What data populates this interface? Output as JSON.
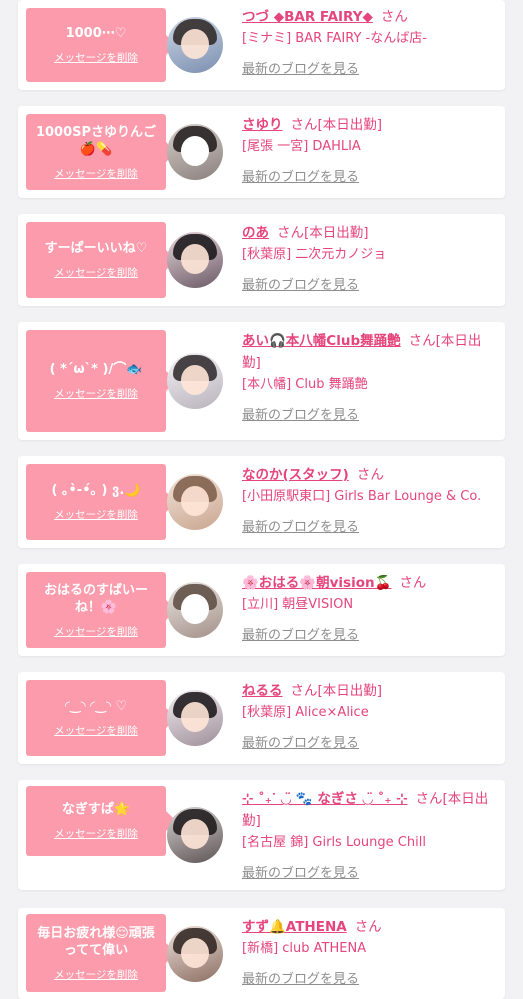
{
  "delete_label": "メッセージを削除",
  "blog_label": "最新のブログを見る",
  "honorific": "さん",
  "colors": {
    "bubble": "#fb9bab",
    "accent": "#e5457b",
    "link_gray": "#8e8e8e",
    "background": "#f2f1f3"
  },
  "items": [
    {
      "message": "1000⋯♡",
      "name": "つづ ◆BAR FAIRY◆",
      "status": "",
      "shop": "[ミナミ] BAR FAIRY -なんば店-"
    },
    {
      "message": "1000SPさゆりんご🍎💊",
      "name": "さゆり",
      "status": "[本日出勤]",
      "shop": "[尾張 一宮] DAHLIA"
    },
    {
      "message": "すーぱーいいね♡",
      "name": "のあ",
      "status": "[本日出勤]",
      "shop": "[秋葉原] 二次元カノジョ"
    },
    {
      "message": "( *´ω`* )/⌒🐟",
      "name": "あい🎧本八幡Club舞踊艶",
      "status": "[本日出勤]",
      "shop": "[本八幡] Club 舞踊艶"
    },
    {
      "message": "( ｡•̀-•́｡ ) ვ.🌙",
      "name": "なのか(スタッフ)",
      "status": "",
      "shop": "[小田原駅東口] Girls Bar Lounge & Co."
    },
    {
      "message": "おはるのすばいーね！🌸",
      "name": "🌸おはる🌸朝vision🍒",
      "status": "",
      "shop": "[立川] 朝昼VISION"
    },
    {
      "message": "◜‿◝ ◜‿◝ ♡",
      "name": "ねるる",
      "status": "[本日出勤]",
      "shop": "[秋葉原] Alice×Alice"
    },
    {
      "message": "なぎすぱ🌟",
      "name": "⊹ ˚₊ᐝ ◡̈ 🐾 なぎさ ◡̈ ˚₊ ⊹",
      "status": "[本日出勤]",
      "shop": "[名古屋 錦] Girls Lounge Chill"
    },
    {
      "message": "毎日お疲れ様😌頑張ってて偉い",
      "name": "すず🔔ATHENA",
      "status": "",
      "shop": "[新橋] club ATHENA"
    }
  ]
}
